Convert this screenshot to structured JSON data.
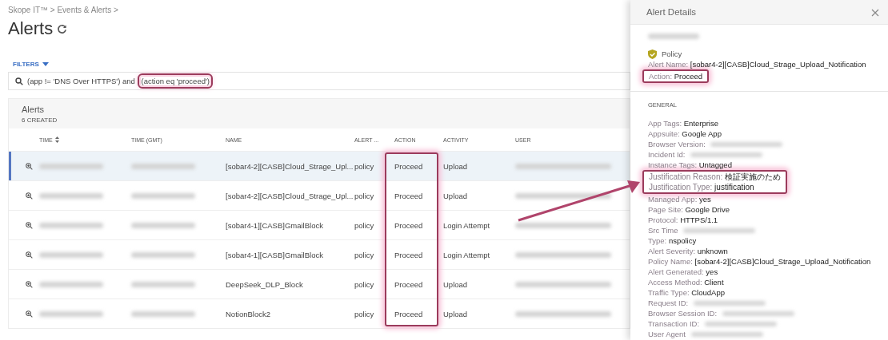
{
  "breadcrumb": "Skope IT™ > Events & Alerts >",
  "title": "Alerts",
  "filters_label": "FILTERS",
  "search": {
    "segments": [
      {
        "text": "(app != 'DNS Over HTTPS') and ",
        "highlighted": false
      },
      {
        "text": "(action eq 'proceed')",
        "highlighted": true
      }
    ]
  },
  "alerts_card": {
    "title": "Alerts",
    "count": "6 CREATED"
  },
  "table": {
    "columns": [
      {
        "label": "TIME",
        "sorted": true,
        "highlighted": false
      },
      {
        "label": "TIME (GMT)",
        "sorted": false,
        "highlighted": false
      },
      {
        "label": "NAME",
        "sorted": false,
        "highlighted": false
      },
      {
        "label": "ALERT ...",
        "sorted": false,
        "highlighted": false
      },
      {
        "label": "ACTION",
        "sorted": false,
        "highlighted": true
      },
      {
        "label": "ACTIVITY",
        "sorted": false,
        "highlighted": false
      },
      {
        "label": "USER",
        "sorted": false,
        "highlighted": false
      }
    ],
    "rows": [
      {
        "selected": true,
        "name": "[sobar4-2][CASB]Cloud_Strage_Upl...",
        "alert_type": "policy",
        "action": "Proceed",
        "activity": "Upload"
      },
      {
        "selected": false,
        "name": "[sobar4-2][CASB]Cloud_Strage_Upl...",
        "alert_type": "policy",
        "action": "Proceed",
        "activity": "Upload"
      },
      {
        "selected": false,
        "name": "[sobar4-1][CASB]GmailBlock",
        "alert_type": "policy",
        "action": "Proceed",
        "activity": "Login Attempt"
      },
      {
        "selected": false,
        "name": "[sobar4-1][CASB]GmailBlock",
        "alert_type": "policy",
        "action": "Proceed",
        "activity": "Login Attempt"
      },
      {
        "selected": false,
        "name": "DeepSeek_DLP_Block",
        "alert_type": "policy",
        "action": "Proceed",
        "activity": "Upload"
      },
      {
        "selected": false,
        "name": "NotionBlock2",
        "alert_type": "policy",
        "action": "Proceed",
        "activity": "Upload"
      }
    ]
  },
  "details": {
    "title": "Alert Details",
    "type_label": "Policy",
    "summary": [
      {
        "label": "Alert Name:",
        "value": "[sobar4-2][CASB]Cloud_Strage_Upload_Notification",
        "highlighted": false
      },
      {
        "label": "Action:",
        "value": "Proceed",
        "highlighted": true
      }
    ],
    "section": "GENERAL",
    "fields": [
      {
        "label": "App Tags:",
        "value": "Enterprise",
        "highlighted": false
      },
      {
        "label": "Appsuite:",
        "value": "Google App",
        "highlighted": false
      },
      {
        "label": "Browser Version:",
        "kind": "redacted",
        "highlighted": false
      },
      {
        "label": "Incident Id:",
        "kind": "redacted",
        "highlighted": false
      },
      {
        "label": "Instance Tags:",
        "value": "Untagged",
        "highlighted": false
      },
      {
        "label": "Justification Reason:",
        "value": "検証実施のため",
        "highlighted": true
      },
      {
        "label": "Justification Type:",
        "value": "justification",
        "highlighted": true
      },
      {
        "label": "Managed App:",
        "value": "yes",
        "highlighted": false
      },
      {
        "label": "Page Site:",
        "value": "Google Drive",
        "highlighted": false
      },
      {
        "label": "Protocol:",
        "value": "HTTPS/1.1",
        "highlighted": false
      },
      {
        "label": "Src Time",
        "kind": "redacted",
        "highlighted": false
      },
      {
        "label": "Type:",
        "value": "nspolicy",
        "highlighted": false
      },
      {
        "label": "Alert Severity:",
        "value": "unknown",
        "highlighted": false
      },
      {
        "label": "Policy Name:",
        "value": "[sobar4-2][CASB]Cloud_Strage_Upload_Notification",
        "highlighted": false
      },
      {
        "label": "Alert Generated:",
        "value": "yes",
        "highlighted": false
      },
      {
        "label": "Access Method:",
        "value": "Client",
        "highlighted": false
      },
      {
        "label": "Traffic Type:",
        "value": "CloudApp",
        "highlighted": false
      },
      {
        "label": "Request ID:",
        "kind": "redacted",
        "highlighted": false
      },
      {
        "label": "Browser Session ID:",
        "kind": "redacted",
        "highlighted": false
      },
      {
        "label": "Transaction ID:",
        "kind": "redacted",
        "highlighted": false
      },
      {
        "label": "User Agent",
        "kind": "redacted",
        "highlighted": false
      }
    ]
  }
}
